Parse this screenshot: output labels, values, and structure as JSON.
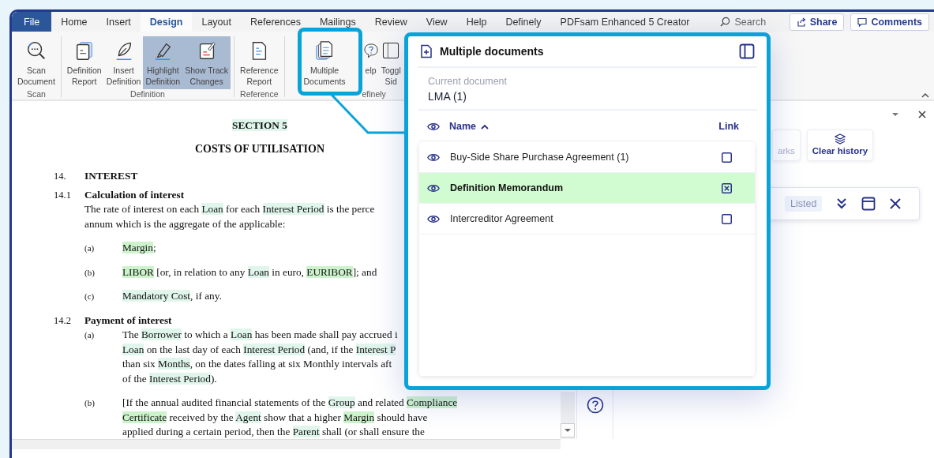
{
  "tabs": [
    {
      "label": "File",
      "kind": "file",
      "selected": false
    },
    {
      "label": "Home",
      "kind": "tab",
      "selected": false
    },
    {
      "label": "Insert",
      "kind": "tab",
      "selected": false
    },
    {
      "label": "Design",
      "kind": "tab",
      "selected": true
    },
    {
      "label": "Layout",
      "kind": "tab",
      "selected": false
    },
    {
      "label": "References",
      "kind": "tab",
      "selected": false
    },
    {
      "label": "Mailings",
      "kind": "tab",
      "selected": false
    },
    {
      "label": "Review",
      "kind": "tab",
      "selected": false
    },
    {
      "label": "View",
      "kind": "tab",
      "selected": false
    },
    {
      "label": "Help",
      "kind": "tab",
      "selected": false
    },
    {
      "label": "Definely",
      "kind": "tab",
      "selected": false
    },
    {
      "label": "PDFsam Enhanced 5 Creator",
      "kind": "tab",
      "selected": false
    }
  ],
  "search": {
    "placeholder": "Search"
  },
  "header_buttons": [
    {
      "label": "Share"
    },
    {
      "label": "Comments"
    }
  ],
  "ribbon": {
    "groups": [
      {
        "label": "Scan",
        "buttons": [
          {
            "lines": [
              "Scan",
              "Document"
            ],
            "selected": false
          }
        ]
      },
      {
        "label": "Definition",
        "buttons": [
          {
            "lines": [
              "Definition",
              "Report"
            ],
            "selected": false
          },
          {
            "lines": [
              "Insert",
              "Definition"
            ],
            "selected": false
          },
          {
            "lines": [
              "Highlight",
              "Definition"
            ],
            "selected": true
          },
          {
            "lines": [
              "Show Track",
              "Changes"
            ],
            "selected": true
          }
        ]
      },
      {
        "label": "Reference",
        "buttons": [
          {
            "lines": [
              "Reference",
              "Report"
            ],
            "selected": false
          }
        ]
      },
      {
        "label": "efinely",
        "buttons": [
          {
            "lines": [
              "Multiple",
              "Documents"
            ],
            "selected": false
          },
          {
            "lines": [
              "elp"
            ],
            "selected": false
          },
          {
            "lines": [
              "Toggl",
              "Sid"
            ],
            "selected": false
          }
        ]
      }
    ]
  },
  "document": {
    "blocks": [
      {
        "kind": "section",
        "lines": [
          [
            {
              "text": "SECTION 5",
              "color": "#e0f6ec"
            }
          ]
        ]
      },
      {
        "kind": "title",
        "lines": [
          [
            {
              "text": "COSTS OF UTILISATION"
            }
          ]
        ]
      },
      {
        "kind": "clause",
        "number": "14.",
        "heading": "INTEREST"
      },
      {
        "kind": "clause",
        "number": "14.1",
        "heading": "Calculation of interest",
        "lines": [
          [
            {
              "text": "The rate of interest on each "
            },
            {
              "text": "Loan",
              "color": "#e0f6ec"
            },
            {
              "text": " for each "
            },
            {
              "text": "Interest Period",
              "color": "#e0f6ec"
            },
            {
              "text": " is the perce"
            }
          ],
          [
            {
              "text": "annum which is the aggregate of the applicable:"
            }
          ]
        ]
      },
      {
        "kind": "item",
        "number": "(a)",
        "lines": [
          [
            {
              "text": "Margin",
              "color": "#cdf3cd"
            },
            {
              "text": ";"
            }
          ]
        ]
      },
      {
        "kind": "item",
        "number": "(b)",
        "lines": [
          [
            {
              "text": "LIBOR",
              "color": "#cdf3cd"
            },
            {
              "text": " [or, in relation to any "
            },
            {
              "text": "Loan",
              "color": "#e0f6ec"
            },
            {
              "text": " in euro, "
            },
            {
              "text": "EURIBOR",
              "color": "#cdf3cd"
            },
            {
              "text": "]; and"
            }
          ]
        ]
      },
      {
        "kind": "item",
        "number": "(c)",
        "lines": [
          [
            {
              "text": "Mandatory Cost",
              "color": "#e0f6ec"
            },
            {
              "text": ", if any."
            }
          ]
        ]
      },
      {
        "kind": "clause",
        "number": "14.2",
        "heading": "Payment of interest"
      },
      {
        "kind": "item",
        "number": "(a)",
        "lines": [
          [
            {
              "text": "The "
            },
            {
              "text": "Borrower",
              "color": "#e0f6ec"
            },
            {
              "text": " to which a "
            },
            {
              "text": "Loan",
              "color": "#e0f6ec"
            },
            {
              "text": " has been made shall pay accrued i"
            }
          ],
          [
            {
              "text": "Loan",
              "color": "#e0f6ec"
            },
            {
              "text": " on the last day of each "
            },
            {
              "text": "Interest Period",
              "color": "#e0f6ec"
            },
            {
              "text": " (and, if the "
            },
            {
              "text": "Interest P",
              "color": "#e0f6ec"
            }
          ],
          [
            {
              "text": "than six "
            },
            {
              "text": "Months",
              "color": "#e0f6ec"
            },
            {
              "text": ", on the dates falling at six Monthly intervals aft"
            }
          ],
          [
            {
              "text": "of the "
            },
            {
              "text": "Interest Period",
              "color": "#e0f6ec"
            },
            {
              "text": ")."
            }
          ]
        ]
      },
      {
        "kind": "item",
        "number": "(b)",
        "lines": [
          [
            {
              "text": "[If the annual audited financial statements of the "
            },
            {
              "text": "Group",
              "color": "#e0f6ec"
            },
            {
              "text": " and related "
            },
            {
              "text": "Compliance",
              "color": "#cdf3cd"
            }
          ],
          [
            {
              "text": "Certificate",
              "color": "#cdf3cd"
            },
            {
              "text": " received by the "
            },
            {
              "text": "Agent",
              "color": "#e0f6ec"
            },
            {
              "text": " show that a higher "
            },
            {
              "text": "Margin",
              "color": "#cdf3cd"
            },
            {
              "text": " should have"
            }
          ],
          [
            {
              "text": "applied during a certain period, then the "
            },
            {
              "text": "Parent",
              "color": "#e0f6ec"
            },
            {
              "text": " shall (or shall ensure the"
            }
          ]
        ]
      }
    ]
  },
  "pane": {
    "buttons": [
      {
        "label": "arks",
        "disabled": true
      },
      {
        "label": "Clear history",
        "disabled": false
      }
    ],
    "card": {
      "chip": "Listed"
    }
  },
  "panel": {
    "title": "Multiple documents",
    "current_label": "Current document",
    "current_value": "LMA (1)",
    "columns": [
      "Name",
      "Link"
    ],
    "documents": [
      {
        "name": "Buy-Side Share Purchase Agreement (1)",
        "selected": false,
        "linked": false
      },
      {
        "name": "Definition Memorandum",
        "selected": true,
        "linked": true
      },
      {
        "name": "Intercreditor Agreement",
        "selected": false,
        "linked": false
      }
    ]
  }
}
